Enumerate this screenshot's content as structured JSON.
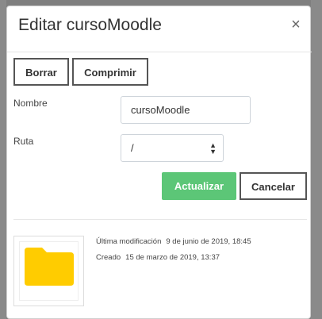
{
  "modal": {
    "title": "Editar cursoMoodle",
    "close_symbol": "×"
  },
  "toolbar": {
    "delete_label": "Borrar",
    "compress_label": "Comprimir"
  },
  "form": {
    "name_label": "Nombre",
    "name_value": "cursoMoodle",
    "path_label": "Ruta",
    "path_value": "/"
  },
  "actions": {
    "update_label": "Actualizar",
    "cancel_label": "Cancelar"
  },
  "file_info": {
    "thumbnail_icon": "folder-icon",
    "modified_label": "Última modificación",
    "modified_value": "9 de junio de 2019, 18:45",
    "created_label": "Creado",
    "created_value": "15 de marzo de 2019, 13:37"
  },
  "colors": {
    "accent_green": "#5cc677",
    "folder_yellow": "#ffcc00",
    "backdrop": "#7f7f7f"
  }
}
